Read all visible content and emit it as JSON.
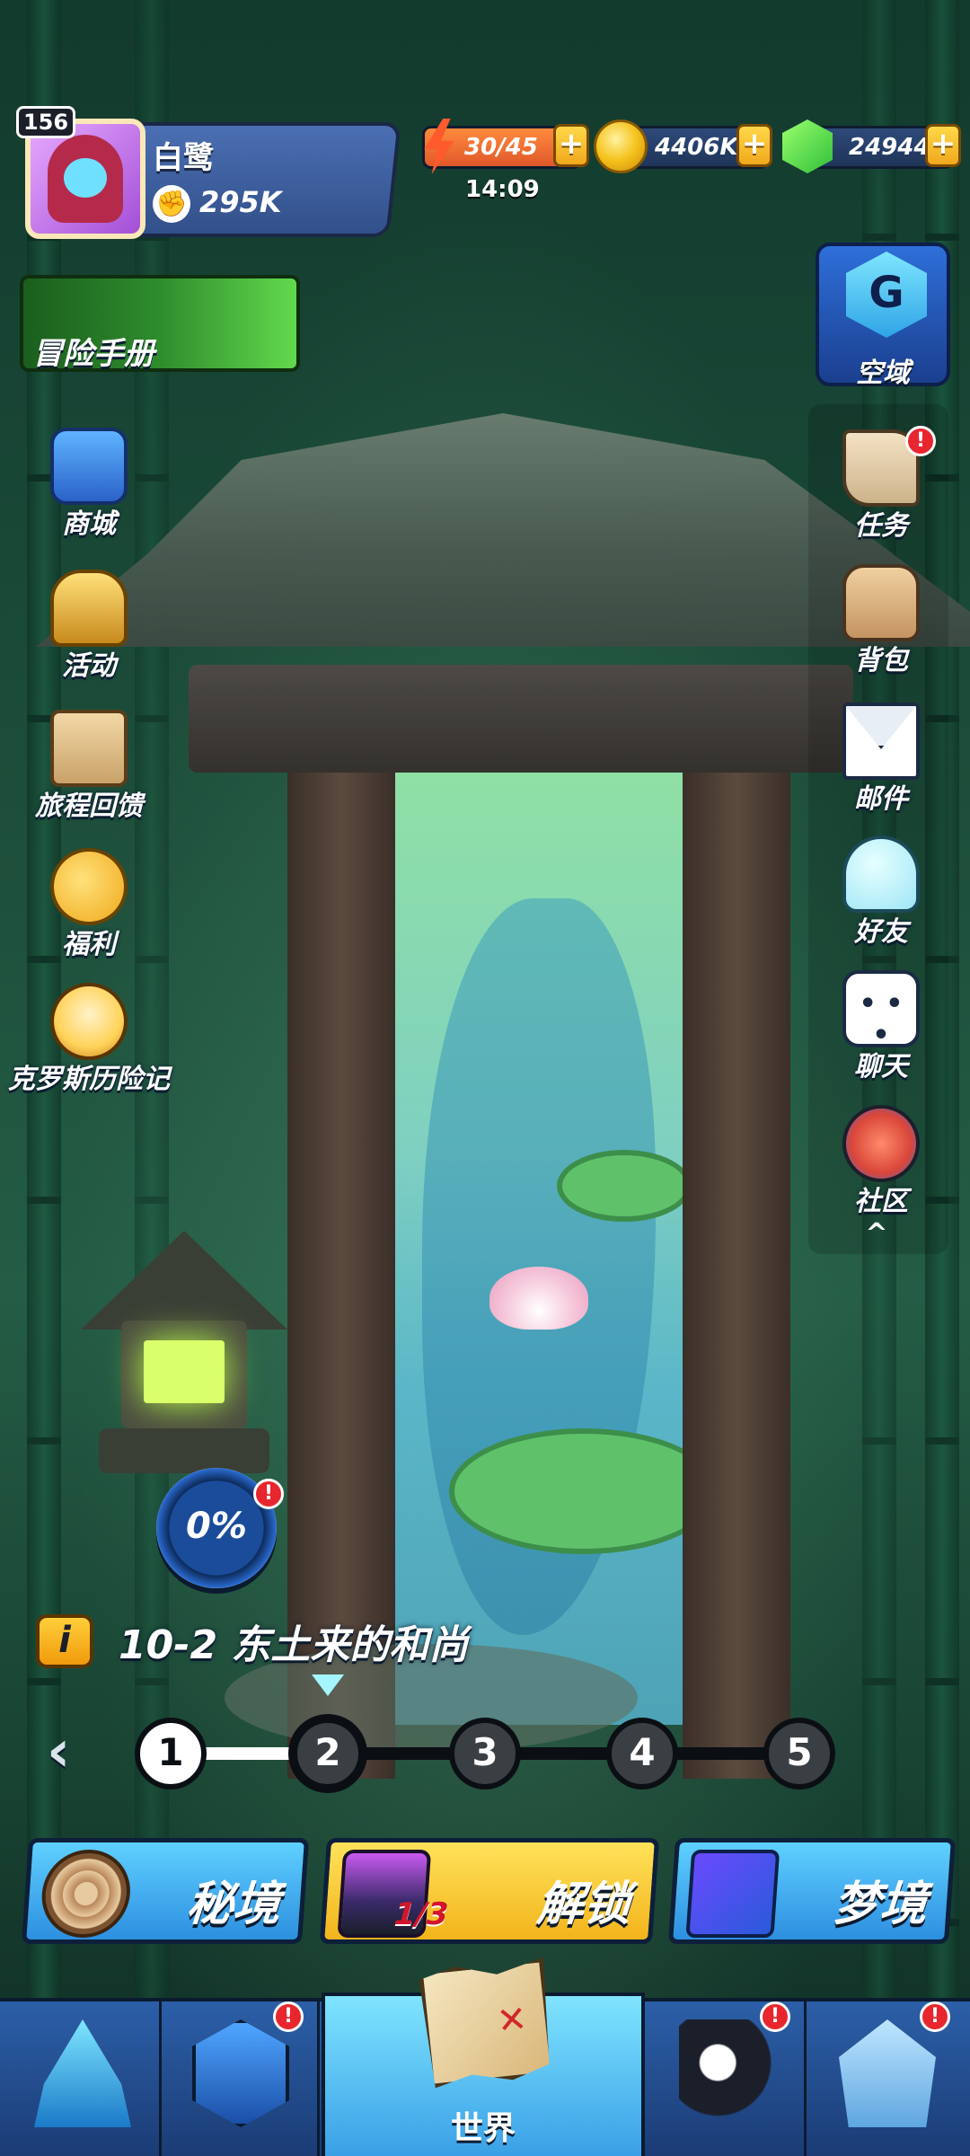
{
  "player": {
    "level": "156",
    "name": "白鹭",
    "power": "295K"
  },
  "resources": {
    "energy": "30/45",
    "energy_timer": "14:09",
    "gold": "4406K",
    "gems": "24944",
    "plus": "+"
  },
  "top_left": {
    "handbook_label": "冒险手册"
  },
  "left_menu": [
    {
      "label": "商城"
    },
    {
      "label": "活动"
    },
    {
      "label": "旅程回馈"
    },
    {
      "label": "福利"
    },
    {
      "label": "克罗斯历险记"
    }
  ],
  "right_top": {
    "label": "空域"
  },
  "right_menu": [
    {
      "label": "任务",
      "alert": "!"
    },
    {
      "label": "背包"
    },
    {
      "label": "邮件"
    },
    {
      "label": "好友"
    },
    {
      "label": "聊天"
    },
    {
      "label": "社区"
    }
  ],
  "collapse_arrow": "^",
  "progress": {
    "percent": "0%",
    "alert": "!"
  },
  "stage": {
    "info_icon": "i",
    "title": "10-2 东土来的和尚",
    "back_arrow": "‹",
    "nodes": [
      "1",
      "2",
      "3",
      "4",
      "5"
    ],
    "current_index": 1,
    "completed_fraction": 0.25
  },
  "actions": {
    "secret_label": "秘境",
    "unlock_label": "解锁",
    "unlock_count": "1/3",
    "dream_label": "梦境"
  },
  "bottom_nav": {
    "world_label": "世界",
    "alert": "!"
  },
  "colors": {
    "accent_blue": "#2d8fe0",
    "accent_yellow": "#f3b41c",
    "alert_red": "#e8262e"
  }
}
